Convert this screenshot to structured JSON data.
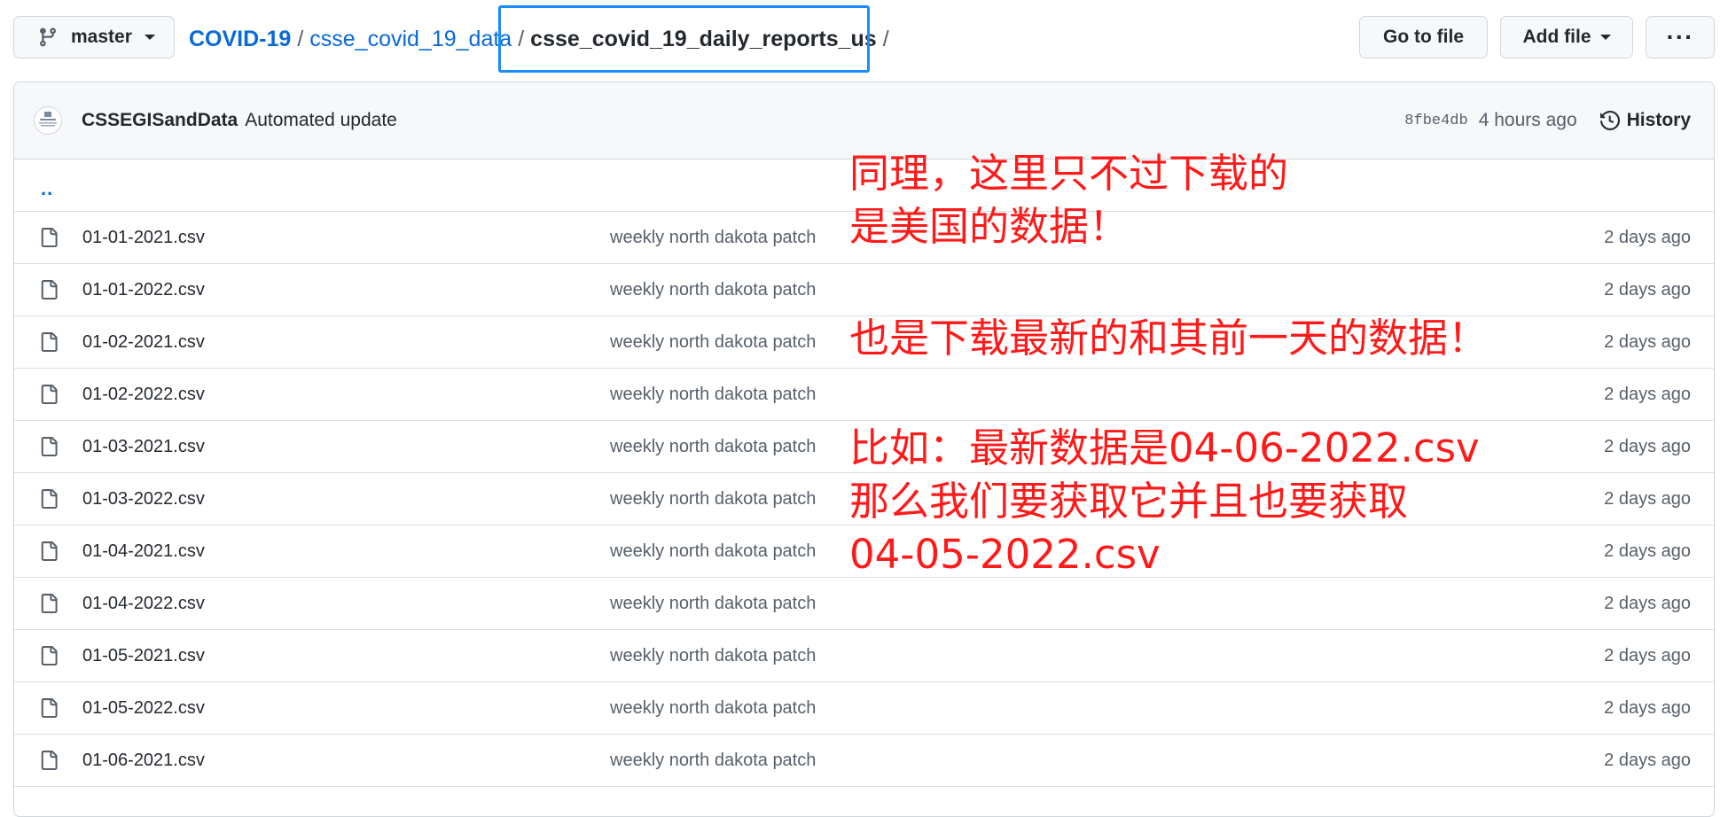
{
  "toolbar": {
    "branch": "master",
    "breadcrumb": {
      "root": "COVID-19",
      "folder": "csse_covid_19_data",
      "current": "csse_covid_19_daily_reports_us",
      "sep": "/"
    },
    "go_to_file": "Go to file",
    "add_file": "Add file",
    "more": "···"
  },
  "commit": {
    "author": "CSSEGISandData",
    "message": "Automated update",
    "sha": "8fbe4db",
    "time": "4 hours ago",
    "history_label": "History"
  },
  "parent_dir": "..",
  "files": [
    {
      "name": "01-01-2021.csv",
      "message": "weekly north dakota patch",
      "date": "2 days ago"
    },
    {
      "name": "01-01-2022.csv",
      "message": "weekly north dakota patch",
      "date": "2 days ago"
    },
    {
      "name": "01-02-2021.csv",
      "message": "weekly north dakota patch",
      "date": "2 days ago"
    },
    {
      "name": "01-02-2022.csv",
      "message": "weekly north dakota patch",
      "date": "2 days ago"
    },
    {
      "name": "01-03-2021.csv",
      "message": "weekly north dakota patch",
      "date": "2 days ago"
    },
    {
      "name": "01-03-2022.csv",
      "message": "weekly north dakota patch",
      "date": "2 days ago"
    },
    {
      "name": "01-04-2021.csv",
      "message": "weekly north dakota patch",
      "date": "2 days ago"
    },
    {
      "name": "01-04-2022.csv",
      "message": "weekly north dakota patch",
      "date": "2 days ago"
    },
    {
      "name": "01-05-2021.csv",
      "message": "weekly north dakota patch",
      "date": "2 days ago"
    },
    {
      "name": "01-05-2022.csv",
      "message": "weekly north dakota patch",
      "date": "2 days ago"
    },
    {
      "name": "01-06-2021.csv",
      "message": "weekly north dakota patch",
      "date": "2 days ago"
    }
  ],
  "annotations": [
    "同理，这里只不过下载的",
    "是美国的数据！",
    "也是下载最新的和其前一天的数据！",
    "比如：最新数据是04-06-2022.csv",
    "那么我们要获取它并且也要获取",
    "04-05-2022.csv"
  ],
  "colors": {
    "link": "#0969da",
    "annotation": "#ff1a1a",
    "highlight_box": "#1a8cff"
  }
}
